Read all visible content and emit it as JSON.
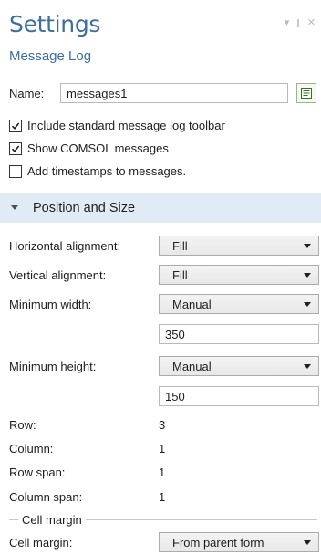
{
  "header": {
    "title": "Settings",
    "subtitle": "Message Log",
    "controls": [
      "▾",
      "❙",
      "✕"
    ]
  },
  "name_field": {
    "label": "Name:",
    "value": "messages1",
    "icon": "notes-icon"
  },
  "checkboxes": [
    {
      "label": "Include standard message log toolbar",
      "checked": true
    },
    {
      "label": "Show COMSOL messages",
      "checked": true
    },
    {
      "label": "Add timestamps to messages.",
      "checked": false
    }
  ],
  "section": {
    "title": "Position and Size"
  },
  "position": {
    "horizontal_alignment": {
      "label": "Horizontal alignment:",
      "value": "Fill"
    },
    "vertical_alignment": {
      "label": "Vertical alignment:",
      "value": "Fill"
    },
    "minimum_width": {
      "label": "Minimum width:",
      "value": "Manual",
      "input": "350"
    },
    "minimum_height": {
      "label": "Minimum height:",
      "value": "Manual",
      "input": "150"
    },
    "row": {
      "label": "Row:",
      "value": "3"
    },
    "column": {
      "label": "Column:",
      "value": "1"
    },
    "row_span": {
      "label": "Row span:",
      "value": "1"
    },
    "column_span": {
      "label": "Column span:",
      "value": "1"
    }
  },
  "cell_margin": {
    "group_title": "Cell margin",
    "label": "Cell margin:",
    "value": "From parent form"
  }
}
